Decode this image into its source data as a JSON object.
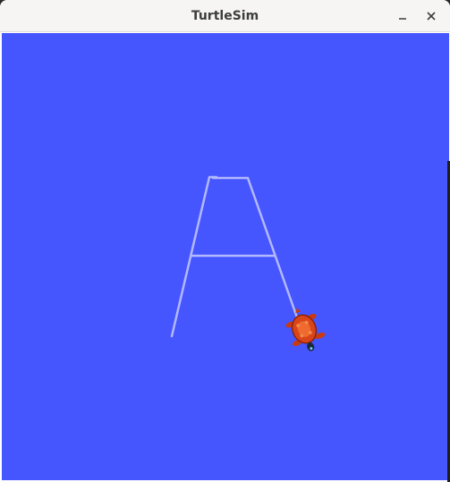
{
  "window": {
    "title": "TurtleSim"
  },
  "titlebar": {
    "minimize_icon": "minimize-icon",
    "close_icon": "close-icon"
  },
  "canvas": {
    "background": "#4556ff",
    "pen_color": "#b3b8ff",
    "turtle_icon": "turtle-icon"
  }
}
